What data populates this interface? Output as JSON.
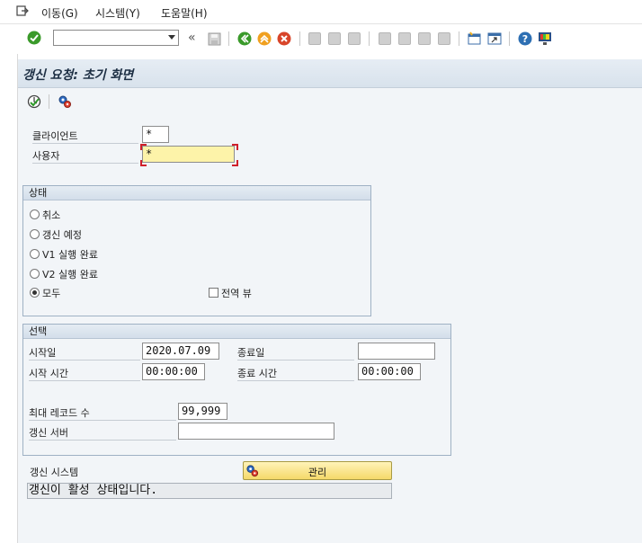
{
  "menu": {
    "items": [
      "이동(G)",
      "시스템(Y)",
      "도움말(H)"
    ]
  },
  "toolbar": {
    "command_value": "",
    "back_symbol": "«"
  },
  "page": {
    "title": "갱신 요청: 초기 화면"
  },
  "header_fields": {
    "client_label": "클라이언트",
    "client_value": "*",
    "user_label": "사용자",
    "user_value": "*"
  },
  "status_group": {
    "title": "상태",
    "options": [
      "취소",
      "갱신 예정",
      "V1 실행 완료",
      "V2 실행 완료",
      "모두"
    ],
    "selected": "모두",
    "global_view_label": "전역 뷰",
    "global_view_checked": false
  },
  "selection_group": {
    "title": "선택",
    "start_date_label": "시작일",
    "start_date_value": "2020.07.09",
    "end_date_label": "종료일",
    "end_date_value": "",
    "start_time_label": "시작 시간",
    "start_time_value": "00:00:00",
    "end_time_label": "종료 시간",
    "end_time_value": "00:00:00",
    "max_records_label": "최대 레코드 수",
    "max_records_value": "99,999",
    "update_server_label": "갱신 서버",
    "update_server_value": ""
  },
  "update_system": {
    "label": "갱신 시스템",
    "button_label": "관리",
    "status_text": "갱신이 활성 상태입니다."
  },
  "colors": {
    "title_bar": "#dce5ee",
    "content_bg": "#f2f5f8",
    "required_field": "#fdf3a9",
    "button_yellow": "#f5d96a",
    "ok_green": "#3a9a2a"
  }
}
